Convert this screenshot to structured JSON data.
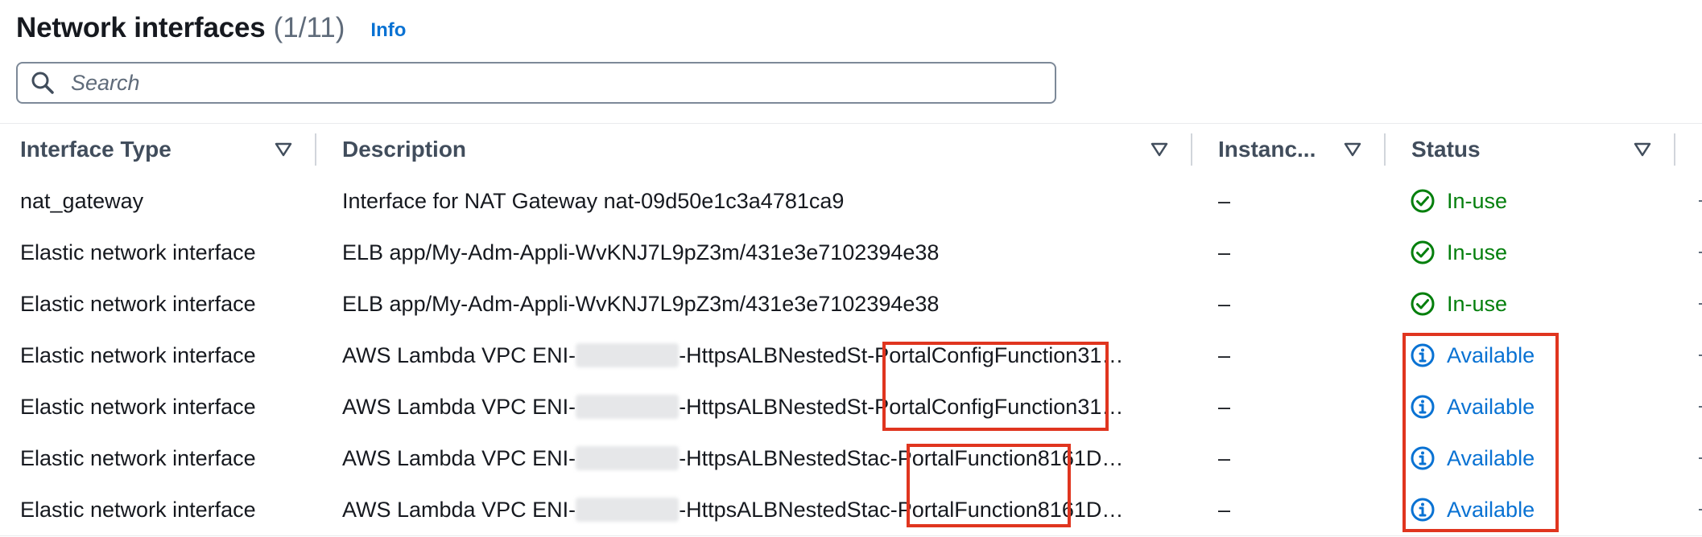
{
  "header": {
    "title": "Network interfaces",
    "count": "(1/11)",
    "info": "Info"
  },
  "search": {
    "placeholder": "Search",
    "value": ""
  },
  "columns": [
    {
      "label": "Interface Type"
    },
    {
      "label": "Description"
    },
    {
      "label": "Instanc..."
    },
    {
      "label": "Status"
    }
  ],
  "rows": [
    {
      "type": "nat_gateway",
      "desc_a": "Interface for NAT Gateway nat-09d50e1c3a4781ca9",
      "desc_b": "",
      "instance": "–",
      "status": "In-use"
    },
    {
      "type": "Elastic network interface",
      "desc_a": "ELB app/My-Adm-Appli-WvKNJ7L9pZ3m/431e3e7102394e38",
      "desc_b": "",
      "instance": "–",
      "status": "In-use"
    },
    {
      "type": "Elastic network interface",
      "desc_a": "ELB app/My-Adm-Appli-WvKNJ7L9pZ3m/431e3e7102394e38",
      "desc_b": "",
      "instance": "–",
      "status": "In-use"
    },
    {
      "type": "Elastic network interface",
      "desc_a": "AWS Lambda VPC ENI-",
      "desc_b": "-HttpsALBNestedSt-PortalConfigFunction31…",
      "instance": "–",
      "status": "Available"
    },
    {
      "type": "Elastic network interface",
      "desc_a": "AWS Lambda VPC ENI-",
      "desc_b": "-HttpsALBNestedSt-PortalConfigFunction31…",
      "instance": "–",
      "status": "Available"
    },
    {
      "type": "Elastic network interface",
      "desc_a": "AWS Lambda VPC ENI-",
      "desc_b": "-HttpsALBNestedStac-PortalFunction8161D…",
      "instance": "–",
      "status": "Available"
    },
    {
      "type": "Elastic network interface",
      "desc_a": "AWS Lambda VPC ENI-",
      "desc_b": "-HttpsALBNestedStac-PortalFunction8161D…",
      "instance": "–",
      "status": "Available"
    }
  ],
  "colors": {
    "in_use": "#037f0c",
    "available": "#0972d3",
    "highlight": "#e0351f",
    "link": "#0972d3"
  }
}
